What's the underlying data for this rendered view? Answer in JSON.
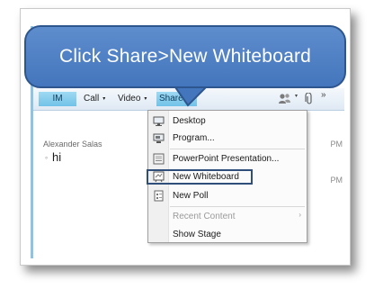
{
  "callout": {
    "text": "Click Share>New Whiteboard"
  },
  "toolbar": {
    "im": "IM",
    "call": "Call",
    "video": "Video",
    "share": "Share",
    "caret": "▾",
    "more": "»"
  },
  "conversation": {
    "sender": "Alexander Salas",
    "message": "hi",
    "time_partial_1": "PM",
    "time_partial_2": "PM"
  },
  "share_menu": {
    "items": [
      {
        "label": "Desktop",
        "icon": "desktop-icon",
        "enabled": true
      },
      {
        "label": "Program...",
        "icon": "program-icon",
        "enabled": true
      },
      {
        "label": "PowerPoint Presentation...",
        "icon": "powerpoint-icon",
        "enabled": true
      },
      {
        "label": "New Whiteboard",
        "icon": "whiteboard-icon",
        "enabled": true,
        "highlighted": true
      },
      {
        "label": "New Poll",
        "icon": "poll-icon",
        "enabled": true
      },
      {
        "label": "Recent Content",
        "enabled": false,
        "submenu": "›"
      },
      {
        "label": "Show Stage",
        "enabled": true
      }
    ]
  },
  "colors": {
    "callout": "#4f80c4",
    "toolbar_active": "#7fcbec",
    "highlight_border": "#2f4f7a"
  }
}
